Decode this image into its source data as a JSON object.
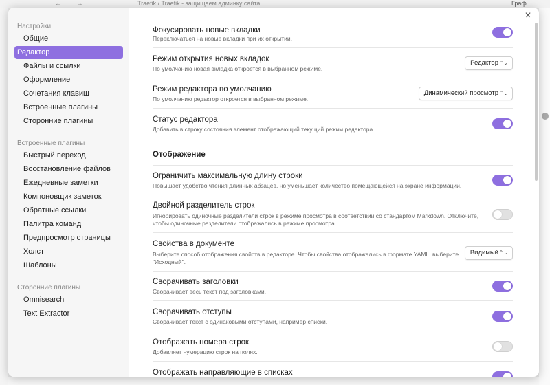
{
  "background": {
    "tab_title": "Traefik / Traefik - защищаем админку сайта",
    "graph_label": "Граф"
  },
  "modal": {
    "close_icon": "×"
  },
  "sidebar": {
    "groups": [
      {
        "header": "Настройки",
        "items": [
          "Общие",
          "Редактор",
          "Файлы и ссылки",
          "Оформление",
          "Сочетания клавиш",
          "Встроенные плагины",
          "Сторонние плагины"
        ],
        "active_index": 1
      },
      {
        "header": "Встроенные плагины",
        "items": [
          "Быстрый переход",
          "Восстановление файлов",
          "Ежедневные заметки",
          "Компоновщик заметок",
          "Обратные ссылки",
          "Палитра команд",
          "Предпросмотр страницы",
          "Холст",
          "Шаблоны"
        ]
      },
      {
        "header": "Сторонние плагины",
        "items": [
          "Omnisearch",
          "Text Extractor"
        ]
      }
    ]
  },
  "settings": {
    "focus_new_tabs": {
      "name": "Фокусировать новые вкладки",
      "desc": "Переключаться на новые вкладки при их открытии.",
      "enabled": true
    },
    "new_tab_mode": {
      "name": "Режим открытия новых вкладок",
      "desc": "По умолчанию новая вкладка откроется в выбранном режиме.",
      "value": "Редактор"
    },
    "default_editor_mode": {
      "name": "Режим редактора по умолчанию",
      "desc": "По умолчанию редактор откроется в выбранном режиме.",
      "value": "Динамический просмотр"
    },
    "editor_status": {
      "name": "Статус редактора",
      "desc": "Добавить в строку состояния элемент отображающий текущий режим редактора.",
      "enabled": true
    },
    "display_section_title": "Отображение",
    "readable_line_length": {
      "name": "Ограничить максимальную длину строки",
      "desc": "Повышает удобство чтения длинных абзацев, но уменьшает количество помещающейся на экране информации.",
      "enabled": true
    },
    "strict_line_breaks": {
      "name": "Двойной разделитель строк",
      "desc1": "Игнорировать одиночные разделители строк в режиме просмотра в соответствии со стандартом Markdown. Отключите,",
      "desc2": "чтобы одиночные разделители отображались в режиме просмотра.",
      "enabled": false
    },
    "properties_in_document": {
      "name": "Свойства в документе",
      "desc1": "Выберите способ отображения свойств в редакторе. Чтобы свойства отображались в формате YAML, выберите",
      "desc2": "\"Исходный\".",
      "value": "Видимый"
    },
    "fold_headings": {
      "name": "Сворачивать заголовки",
      "desc": "Сворачивает весь текст под заголовками.",
      "enabled": true
    },
    "fold_indent": {
      "name": "Сворачивать отступы",
      "desc": "Сворачивает текст с одинаковыми отступами, например списки.",
      "enabled": true
    },
    "line_numbers": {
      "name": "Отображать номера строк",
      "desc": "Добавляет нумерацию строк на полях.",
      "enabled": false
    },
    "indent_guides": {
      "name": "Отображать направляющие в списках",
      "enabled": true
    }
  },
  "colors": {
    "accent": "#8e6fe0",
    "toggle_off": "#e1e1e1"
  }
}
